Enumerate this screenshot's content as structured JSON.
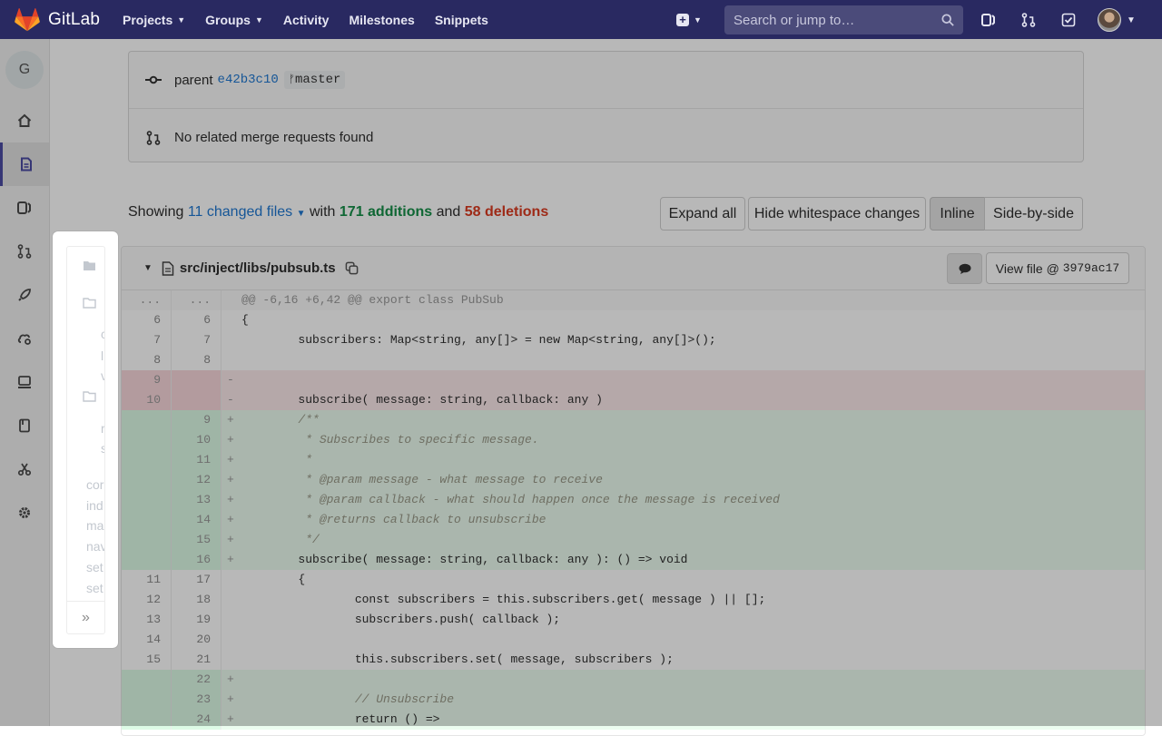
{
  "navbar": {
    "brand": "GitLab",
    "links": [
      {
        "label": "Projects",
        "dropdown": true
      },
      {
        "label": "Groups",
        "dropdown": true
      },
      {
        "label": "Activity",
        "dropdown": false
      },
      {
        "label": "Milestones",
        "dropdown": false
      },
      {
        "label": "Snippets",
        "dropdown": false
      }
    ],
    "search_placeholder": "Search or jump to…",
    "bg_color": "#292961"
  },
  "sidebar": {
    "project_letter": "G",
    "items": [
      "home-icon",
      "file-icon",
      "issues-icon",
      "merge-request-icon",
      "rocket-icon",
      "cloud-gear-icon",
      "monitor-icon",
      "book-icon",
      "scissors-icon",
      "settings-icon"
    ],
    "active_index": 1
  },
  "commit": {
    "parent_label": "parent",
    "parent_sha": "e42b3c10",
    "branch": "master",
    "merge_requests_text": "No related merge requests found"
  },
  "stats": {
    "showing": "Showing",
    "changed_files": "11 changed files",
    "with": "with",
    "additions": "171 additions",
    "and": "and",
    "deletions": "58 deletions"
  },
  "buttons": {
    "expand_all": "Expand all",
    "hide_whitespace": "Hide whitespace changes",
    "inline": "Inline",
    "side_by_side": "Side-by-side"
  },
  "file": {
    "path": "src/inject/libs/pubsub.ts",
    "view_file_label": "View file @",
    "view_file_sha": "3979ac17"
  },
  "diff_lines": [
    {
      "type": "hunk",
      "old": "...",
      "new": "...",
      "sign": "",
      "code": "@@ -6,16 +6,42 @@ export class PubSub"
    },
    {
      "type": "ctx",
      "old": "6",
      "new": "6",
      "sign": " ",
      "code": "{"
    },
    {
      "type": "ctx",
      "old": "7",
      "new": "7",
      "sign": " ",
      "code": "        subscribers: Map<string, any[]> = new Map<string, any[]>();"
    },
    {
      "type": "ctx",
      "old": "8",
      "new": "8",
      "sign": " ",
      "code": ""
    },
    {
      "type": "old",
      "old": "9",
      "new": "",
      "sign": "-",
      "code": ""
    },
    {
      "type": "old",
      "old": "10",
      "new": "",
      "sign": "-",
      "code": "        subscribe( message: string, callback: any )"
    },
    {
      "type": "new",
      "old": "",
      "new": "9",
      "sign": "+",
      "code": "        /**"
    },
    {
      "type": "new",
      "old": "",
      "new": "10",
      "sign": "+",
      "code": "         * Subscribes to specific message."
    },
    {
      "type": "new",
      "old": "",
      "new": "11",
      "sign": "+",
      "code": "         *"
    },
    {
      "type": "new",
      "old": "",
      "new": "12",
      "sign": "+",
      "code": "         * @param message - what message to receive"
    },
    {
      "type": "new",
      "old": "",
      "new": "13",
      "sign": "+",
      "code": "         * @param callback - what should happen once the message is received"
    },
    {
      "type": "new",
      "old": "",
      "new": "14",
      "sign": "+",
      "code": "         * @returns callback to unsubscribe"
    },
    {
      "type": "new",
      "old": "",
      "new": "15",
      "sign": "+",
      "code": "         */"
    },
    {
      "type": "new",
      "old": "",
      "new": "16",
      "sign": "+",
      "code": "        subscribe( message: string, callback: any ): () => void"
    },
    {
      "type": "ctx",
      "old": "11",
      "new": "17",
      "sign": " ",
      "code": "        {"
    },
    {
      "type": "ctx",
      "old": "12",
      "new": "18",
      "sign": " ",
      "code": "                const subscribers = this.subscribers.get( message ) || [];"
    },
    {
      "type": "ctx",
      "old": "13",
      "new": "19",
      "sign": " ",
      "code": "                subscribers.push( callback );"
    },
    {
      "type": "ctx",
      "old": "14",
      "new": "20",
      "sign": " ",
      "code": ""
    },
    {
      "type": "ctx",
      "old": "15",
      "new": "21",
      "sign": " ",
      "code": "                this.subscribers.set( message, subscribers );"
    },
    {
      "type": "new",
      "old": "",
      "new": "22",
      "sign": "+",
      "code": ""
    },
    {
      "type": "new",
      "old": "",
      "new": "23",
      "sign": "+",
      "code": "                // Unsubscribe"
    },
    {
      "type": "new",
      "old": "",
      "new": "24",
      "sign": "+",
      "code": "                return () =>"
    }
  ],
  "file_tree_popup": {
    "items": [
      "cor",
      "ind",
      "ma",
      "nav",
      "set",
      "set"
    ],
    "partial_chars": [
      "c",
      "l",
      "v",
      "r",
      "s"
    ],
    "collapse_icon": "»"
  }
}
